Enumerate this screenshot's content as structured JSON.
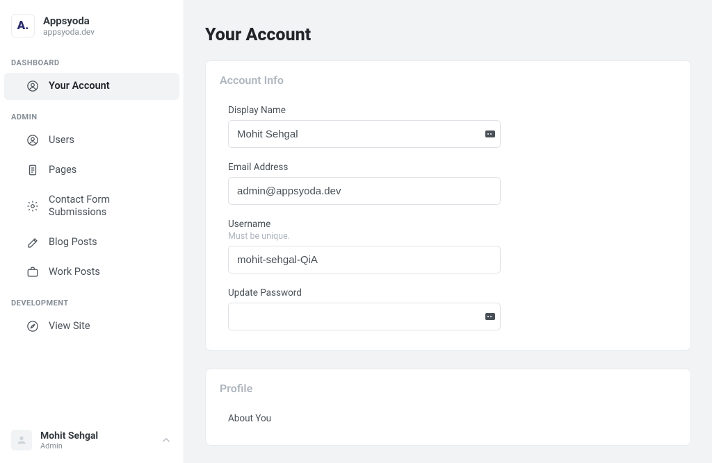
{
  "brand": {
    "logo_text": "A.",
    "title": "Appsyoda",
    "subtitle": "appsyoda.dev"
  },
  "sections": {
    "dashboard_label": "DASHBOARD",
    "admin_label": "ADMIN",
    "development_label": "DEVELOPMENT"
  },
  "nav": {
    "your_account": "Your Account",
    "users": "Users",
    "pages": "Pages",
    "contact_form": "Contact Form Submissions",
    "blog_posts": "Blog Posts",
    "work_posts": "Work Posts",
    "view_site": "View Site"
  },
  "user": {
    "name": "Mohit Sehgal",
    "role": "Admin"
  },
  "page": {
    "title": "Your Account"
  },
  "cards": {
    "account_info": {
      "title": "Account Info",
      "display_name_label": "Display Name",
      "display_name_value": "Mohit Sehgal",
      "email_label": "Email Address",
      "email_value": "admin@appsyoda.dev",
      "username_label": "Username",
      "username_hint": "Must be unique.",
      "username_value": "mohit-sehgal-QiA",
      "password_label": "Update Password",
      "password_value": ""
    },
    "profile": {
      "title": "Profile",
      "about_you_label": "About You"
    }
  }
}
